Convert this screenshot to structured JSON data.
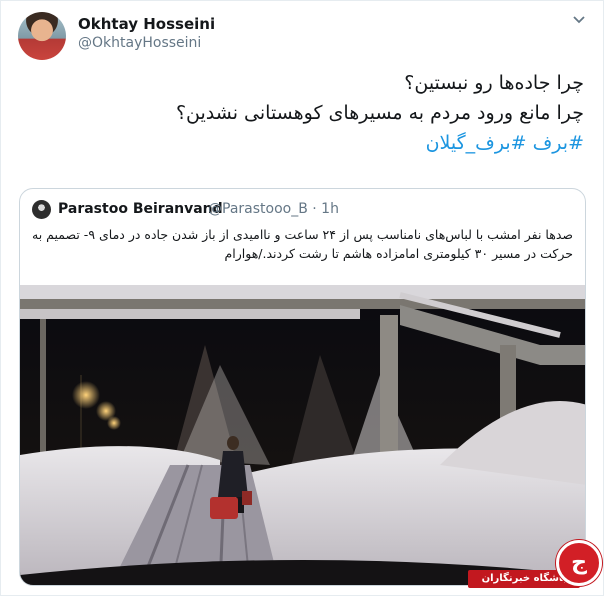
{
  "tweet": {
    "author_name": "Okhtay Hosseini",
    "author_handle": "@OkhtayHosseini",
    "line1": "چرا جاده‌ها رو نبستین؟",
    "line2": "چرا مانع ورود مردم به مسیرهای کوهستانی نشدین؟",
    "hashtag1": "#برف",
    "hashtag2": "#برف_گیلان"
  },
  "quoted": {
    "author_name": "Parastoo Beiranvand",
    "author_handle": "@Parastooo_B · 1h",
    "text": "صدها نفر امشب با لباس‌های نامناسب پس از ۲۴ ساعت و ناامیدی از باز شدن جاده  در دمای ۹- تصمیم به حرکت در مسیر ۳۰ کیلومتری امامزاده هاشم تا رشت کردند./هوارام"
  },
  "watermark": {
    "label": "باشگاه خبرنگاران",
    "glyph": "ج"
  },
  "colors": {
    "hashtag": "#1b95e0",
    "badge": "#c2181f"
  },
  "icons": [
    "chevron-down-icon",
    "avatar",
    "quoted-avatar"
  ]
}
